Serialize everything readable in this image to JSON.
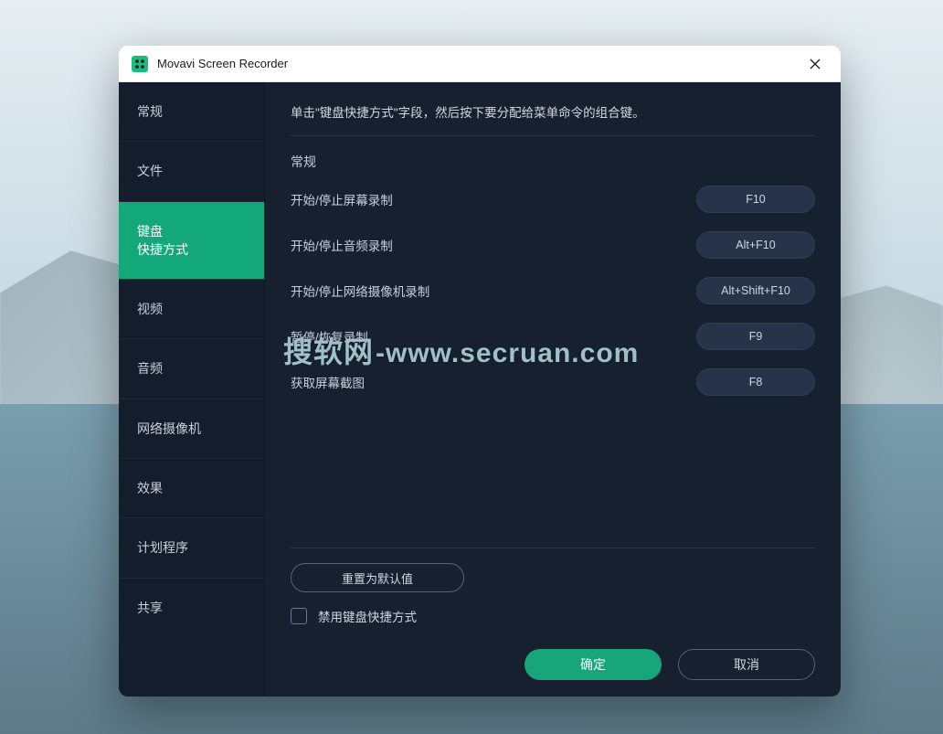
{
  "titlebar": {
    "title": "Movavi Screen Recorder"
  },
  "sidebar": {
    "items": [
      {
        "label": "常规"
      },
      {
        "label": "文件"
      },
      {
        "label": "键盘\n快捷方式"
      },
      {
        "label": "视频"
      },
      {
        "label": "音频"
      },
      {
        "label": "网络摄像机"
      },
      {
        "label": "效果"
      },
      {
        "label": "计划程序"
      },
      {
        "label": "共享"
      }
    ],
    "active_index": 2
  },
  "main": {
    "instruction": "单击\"键盘快捷方式\"字段，然后按下要分配给菜单命令的组合键。",
    "section_title": "常规",
    "shortcuts": [
      {
        "label": "开始/停止屏幕录制",
        "key": "F10"
      },
      {
        "label": "开始/停止音频录制",
        "key": "Alt+F10"
      },
      {
        "label": "开始/停止网络摄像机录制",
        "key": "Alt+Shift+F10"
      },
      {
        "label": "暂停/恢复录制",
        "key": "F9"
      },
      {
        "label": "获取屏幕截图",
        "key": "F8"
      }
    ],
    "reset_label": "重置为默认值",
    "disable_label": "禁用键盘快捷方式",
    "ok_label": "确定",
    "cancel_label": "取消"
  },
  "watermark": {
    "cn": "搜软网",
    "en": "-www.secruan.com"
  }
}
